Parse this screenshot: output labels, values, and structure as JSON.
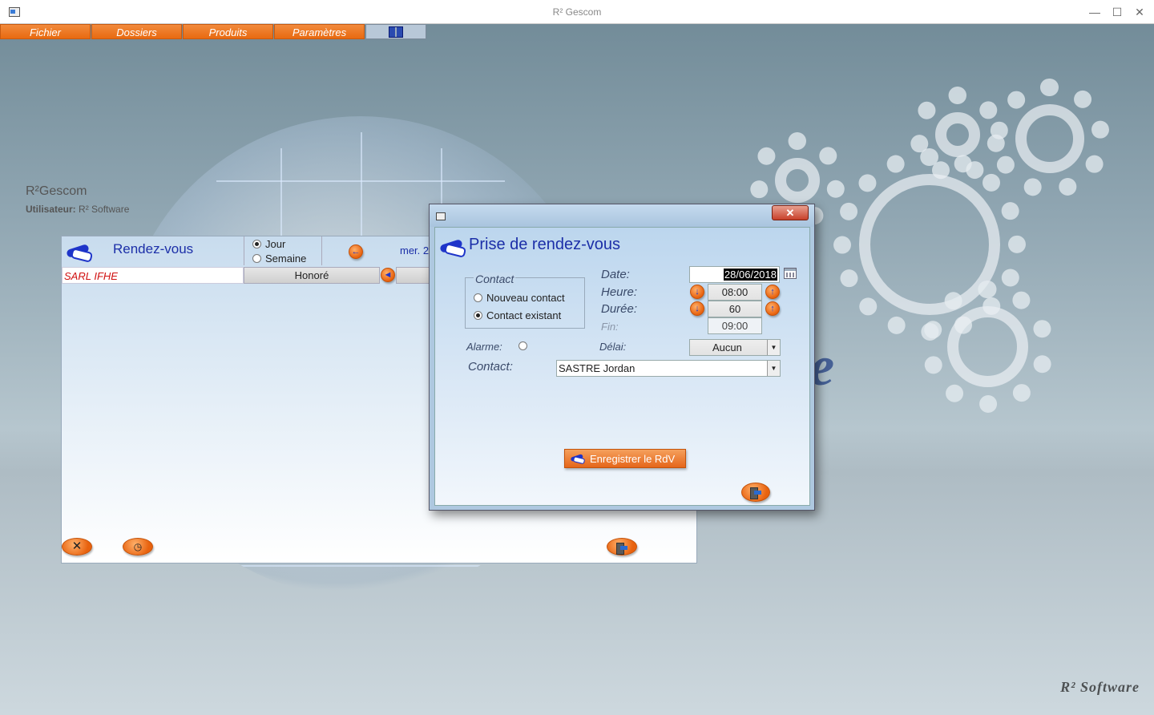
{
  "window": {
    "title": "R² Gescom",
    "controls": {
      "minimize": "—",
      "maximize": "☐",
      "close": "✕"
    }
  },
  "menu": {
    "items": [
      "Fichier",
      "Dossiers",
      "Produits",
      "Paramètres"
    ]
  },
  "brand": {
    "app_name": "R²Gescom",
    "user_label": "Utilisateur:",
    "user_name": "R² Software",
    "footer": "R² Software"
  },
  "rdv_window": {
    "title": "Rendez-vous",
    "view_options": [
      {
        "label": "Jour",
        "selected": true
      },
      {
        "label": "Semaine",
        "selected": false
      }
    ],
    "date_partial": "mer. 2",
    "rows": [
      {
        "company": "SARL IFHE",
        "status": "Honoré"
      }
    ]
  },
  "dialog": {
    "title": "Prise de rendez-vous",
    "close": "✕",
    "contact_group": {
      "legend": "Contact",
      "options": [
        {
          "label": "Nouveau contact",
          "selected": false
        },
        {
          "label": "Contact existant",
          "selected": true
        }
      ]
    },
    "date": {
      "label": "Date:",
      "value": "28/06/2018"
    },
    "heure": {
      "label": "Heure:",
      "value": "08:00"
    },
    "duree": {
      "label": "Durée:",
      "value": "60"
    },
    "fin": {
      "label": "Fin:",
      "value": "09:00"
    },
    "alarme": {
      "label": "Alarme:"
    },
    "delai": {
      "label": "Délai:",
      "value": "Aucun"
    },
    "contact": {
      "label": "Contact:",
      "value": "SASTRE Jordan"
    },
    "save_label": "Enregistrer le RdV"
  },
  "icons": {
    "handshake": "handshake-icon",
    "calendar": "calendar-icon",
    "exit": "exit-door-icon",
    "clock": "clock-icon",
    "cancel": "x-cancel-icon",
    "speaker": "speaker-icon"
  },
  "colors": {
    "accent_orange": "#e8620e",
    "title_blue": "#1c2fa8",
    "company_red": "#d01010"
  }
}
